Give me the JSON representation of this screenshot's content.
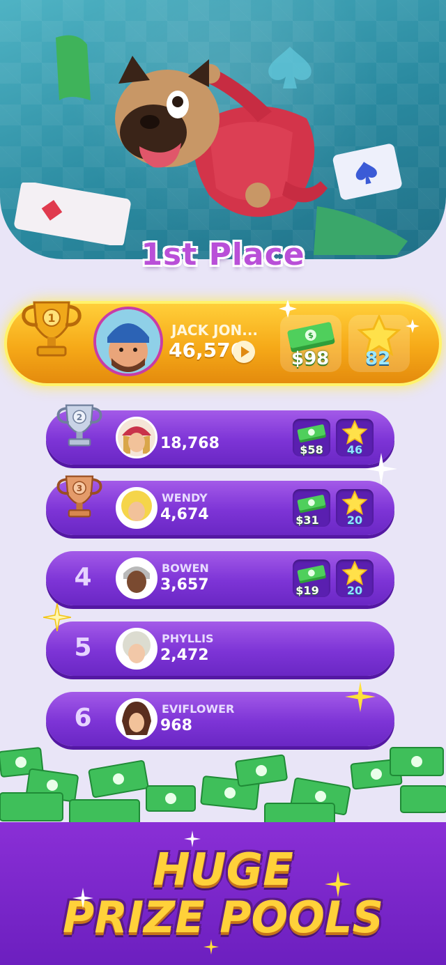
{
  "hero": {
    "title": "1st Place"
  },
  "first_place": {
    "rank": 1,
    "name": "JACK JON...",
    "score": "46,576",
    "cash": "$98",
    "stars": "82"
  },
  "rows": [
    {
      "rank": "2",
      "name": "",
      "score": "18,768",
      "cash": "$58",
      "stars": "46"
    },
    {
      "rank": "3",
      "name": "WENDY",
      "score": "4,674",
      "cash": "$31",
      "stars": "20"
    },
    {
      "rank": "4",
      "name": "BOWEN",
      "score": "3,657",
      "cash": "$19",
      "stars": "20"
    },
    {
      "rank": "5",
      "name": "PHYLLIS",
      "score": "2,472"
    },
    {
      "rank": "6",
      "name": "EVIFLOWER",
      "score": "968"
    }
  ],
  "footer": {
    "line1": "HUGE",
    "line2": "PRIZE POOLS"
  },
  "colors": {
    "gold": "#f6a918",
    "purple": "#7d34d6",
    "title": "#b94fd8",
    "slogan": "#ffd13a"
  }
}
